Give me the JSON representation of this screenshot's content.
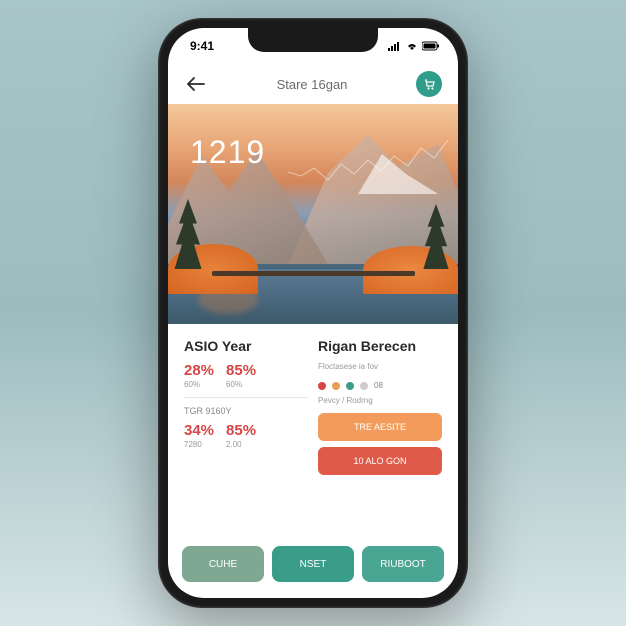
{
  "status": {
    "time": "9:41"
  },
  "nav": {
    "title": "Stare 16gan"
  },
  "hero": {
    "number": "1219"
  },
  "stats_left": {
    "title": "ASIO Year",
    "stat1_big": "28%",
    "stat1_small": "60%",
    "stat2_big": "85%",
    "stat2_small": "60%",
    "label2": "TGR 9160Y",
    "stat3_big": "34%",
    "stat3_small": "7280",
    "stat4_big": "85%",
    "stat4_small": "2.00"
  },
  "stats_right": {
    "title": "Rigan Berecen",
    "subtitle": "Floctasese ia fov",
    "dot_label": "08",
    "caption": "Pevcy / Rodrng"
  },
  "cta": {
    "btn1": "TRE AESITE",
    "btn2": "10 ALO GON"
  },
  "bottom": {
    "btn1": "CUHE",
    "btn2": "NSET",
    "btn3": "RIUBOOT"
  },
  "colors": {
    "dot1": "#d84545",
    "dot2": "#e8a050",
    "dot3": "#3a9d8a",
    "dot4": "#999"
  },
  "chart_data": {
    "type": "line",
    "x": [
      0,
      1,
      2,
      3,
      4,
      5,
      6,
      7,
      8,
      9,
      10,
      11,
      12
    ],
    "values": [
      40,
      35,
      45,
      30,
      50,
      38,
      55,
      42,
      60,
      48,
      70,
      58,
      80
    ],
    "ylim": [
      0,
      100
    ]
  }
}
